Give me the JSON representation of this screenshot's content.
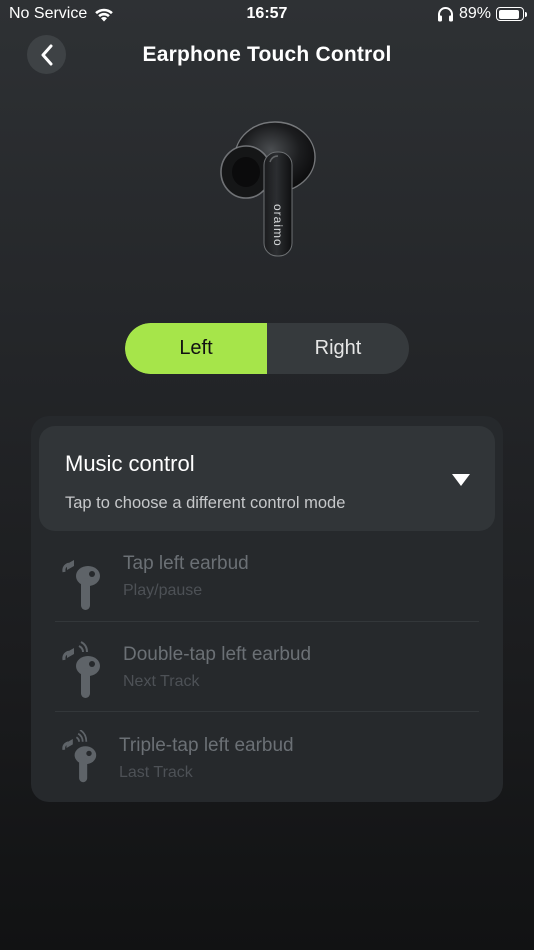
{
  "status_bar": {
    "carrier": "No Service",
    "time": "16:57",
    "battery_percent": "89%",
    "battery_level": 0.89
  },
  "header": {
    "title": "Earphone Touch Control"
  },
  "product": {
    "brand_on_stem": "oraimo"
  },
  "side_selector": {
    "left_label": "Left",
    "right_label": "Right",
    "selected": "Left",
    "accent_color": "#a6e54a"
  },
  "control_mode": {
    "title": "Music control",
    "subtitle": "Tap to choose a different control mode"
  },
  "gestures": [
    {
      "title": "Tap left earbud",
      "action": "Play/pause"
    },
    {
      "title": "Double-tap left earbud",
      "action": "Next Track"
    },
    {
      "title": "Triple-tap left earbud",
      "action": "Last Track"
    }
  ]
}
